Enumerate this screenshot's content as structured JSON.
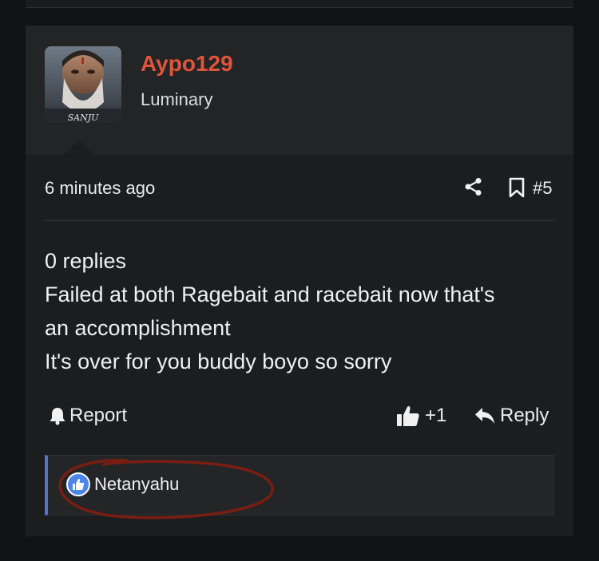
{
  "post": {
    "author": {
      "username": "Aypo129",
      "title": "Luminary",
      "avatar_caption": "SANJU"
    },
    "timestamp": "6 minutes ago",
    "post_number": "#5",
    "content_lines": [
      "0 replies",
      "Failed at both Ragebait and racebait now that's",
      "an accomplishment",
      "It's over for you buddy boyo so sorry"
    ],
    "actions": {
      "report_label": "Report",
      "like_count": "+1",
      "reply_label": "Reply"
    },
    "reactions": {
      "reactor": "Netanyahu",
      "reaction_icon": "thumbs-up-icon"
    }
  },
  "colors": {
    "background": "#111214",
    "card": "#1c1d1f",
    "header": "#232426",
    "username": "#e0543c",
    "reaction_accent": "#5a6fd6",
    "like_blue": "#4c86e8",
    "annotation_red": "#7a1e12"
  }
}
